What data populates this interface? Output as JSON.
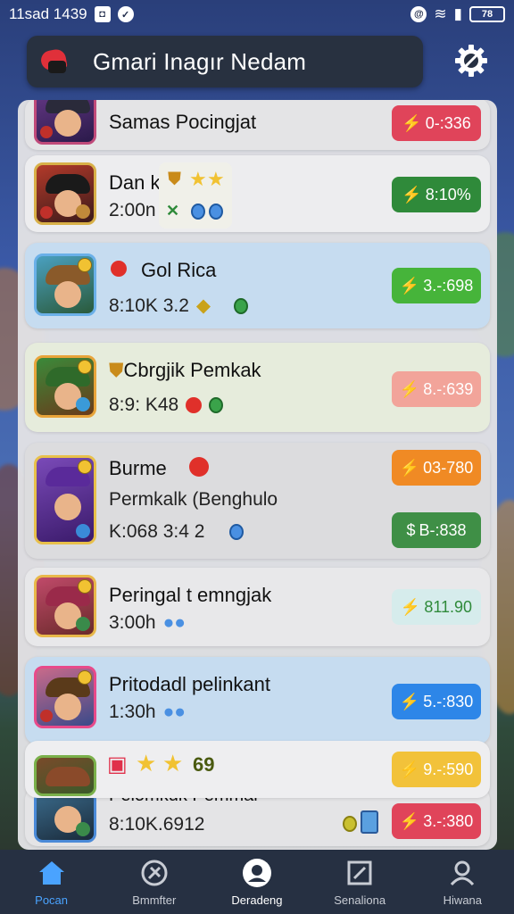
{
  "status_bar": {
    "time": "11sad 1439",
    "battery": "78"
  },
  "header": {
    "title": "Gmari Inagır Nedam"
  },
  "entries": [
    {
      "name": "Samas Pocingjat",
      "meta": "",
      "action": "0-:336",
      "color": "#e0445a"
    },
    {
      "name": "Dan k",
      "meta": "2:00n",
      "action": "8:10%",
      "color": "#2f8a3a"
    },
    {
      "name": "Gol Rica",
      "meta": "8:10K 3.2",
      "action": "3.-:698",
      "color": "#46b43a"
    },
    {
      "name": "Cbrgjik Pemkak",
      "meta": "8:9: K48",
      "action": "8.-:639",
      "color": "#f2a49a"
    },
    {
      "name": "Burme",
      "subtitle": "Permkalk (Benghulo",
      "meta": "K:068 3:4 2",
      "action": "03-780",
      "color": "#f08a24"
    },
    {
      "name": "",
      "meta": "",
      "action": "B-:838",
      "color": "#3f8f46"
    },
    {
      "name": "Peringal t emngjak",
      "meta": "3:00h",
      "action": "811.90",
      "color": "#d6ecec"
    },
    {
      "name": "Pritodadl pelinkant",
      "meta": "1:30h",
      "action": "5.-:830",
      "color": "#2d86e8"
    },
    {
      "name": "69",
      "meta": "",
      "action": "9.-:590",
      "color": "#f2c23a"
    },
    {
      "name": "Pelomkuk Pemmal",
      "meta": "8:10K.6912",
      "action": "3.-:380",
      "color": "#e0445a"
    }
  ],
  "nav": {
    "items": [
      {
        "label": "Pocan",
        "icon": "home-icon"
      },
      {
        "label": "Bmmfter",
        "icon": "tools-icon"
      },
      {
        "label": "Deradeng",
        "icon": "profile-circle-icon"
      },
      {
        "label": "Senaliona",
        "icon": "edit-icon"
      },
      {
        "label": "Hiwana",
        "icon": "user-icon"
      }
    ]
  }
}
